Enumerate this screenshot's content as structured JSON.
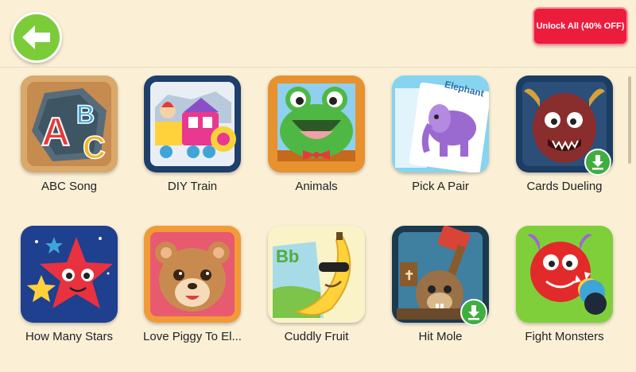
{
  "header": {
    "back_icon": "arrow-left-icon",
    "unlock_label": "Unlock All (40% OFF)"
  },
  "games": [
    {
      "label": "ABC Song",
      "icon": "abc-letters-icon",
      "download": false
    },
    {
      "label": "DIY Train",
      "icon": "toy-train-icon",
      "download": false
    },
    {
      "label": "Animals",
      "icon": "frog-icon",
      "download": false
    },
    {
      "label": "Pick A Pair",
      "icon": "elephant-card-icon",
      "download": false,
      "card_text": "Elephant"
    },
    {
      "label": "Cards Dueling",
      "icon": "monster-icon",
      "download": true
    },
    {
      "label": "How Many Stars",
      "icon": "stars-icon",
      "download": false
    },
    {
      "label": "Love Piggy To El...",
      "icon": "bear-icon",
      "download": false
    },
    {
      "label": "Cuddly Fruit",
      "icon": "banana-icon",
      "download": false,
      "card_text": "Bb"
    },
    {
      "label": "Hit Mole",
      "icon": "mole-hammer-icon",
      "download": true
    },
    {
      "label": "Fight Monsters",
      "icon": "red-monster-icon",
      "download": false
    }
  ],
  "colors": {
    "background": "#fbf0d6",
    "back_button": "#7ccc3a",
    "unlock_button": "#ec1c3c",
    "download_badge": "#3fae3f"
  }
}
